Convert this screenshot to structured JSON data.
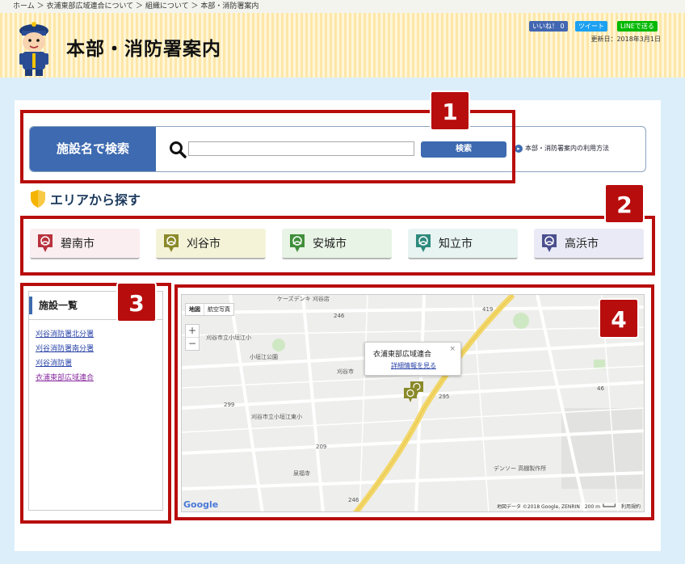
{
  "breadcrumb": "ホーム ＞ 衣浦東部広域連合について ＞ 組織について ＞ 本部・消防署案内",
  "header": {
    "title": "本部・消防署案内",
    "share_fb": "いいね！ 0",
    "share_tw": "ツイート",
    "share_line": "LINEで送る",
    "updated": "更新日：2018年3月1日"
  },
  "search": {
    "label": "施設名で検索",
    "input_value": "",
    "button": "検索",
    "help": "本部・消防署案内の利用方法"
  },
  "area": {
    "heading": "エリアから探す",
    "cities": [
      {
        "label": "碧南市",
        "bg": "#fbeef0",
        "pin": "#b8323d"
      },
      {
        "label": "刈谷市",
        "bg": "#f4f3d8",
        "pin": "#8a8a2a"
      },
      {
        "label": "安城市",
        "bg": "#e8f4e6",
        "pin": "#3f8f3a"
      },
      {
        "label": "知立市",
        "bg": "#e7f4f2",
        "pin": "#2e8a7d"
      },
      {
        "label": "高浜市",
        "bg": "#eaeaf6",
        "pin": "#4b4f8f"
      }
    ]
  },
  "facilities": {
    "title": "施設一覧",
    "items": [
      "刈谷消防署北分署",
      "刈谷消防署南分署",
      "刈谷消防署",
      "衣浦東部広域連合"
    ]
  },
  "map": {
    "type_map": "地図",
    "type_sat": "航空写真",
    "zoom_in": "+",
    "zoom_out": "−",
    "popup_title": "衣浦東部広域連合",
    "popup_link": "詳細情報を見る",
    "popup_close": "×",
    "labels": [
      "ケーズデンキ 刈谷店",
      "刈谷市立小垣江小",
      "小垣江公園",
      "刈谷市立小垣江東小",
      "刈谷市",
      "泉福寺",
      "デンソー 高棚製作所"
    ],
    "route_numbers": [
      "246",
      "419",
      "46",
      "299",
      "295",
      "209",
      "246"
    ],
    "attribution": "地図データ ©2018 Google, ZENRIN　200 m ┗━━━┛　利用規約",
    "google": "Google"
  },
  "callouts": [
    "1",
    "2",
    "3",
    "4"
  ]
}
